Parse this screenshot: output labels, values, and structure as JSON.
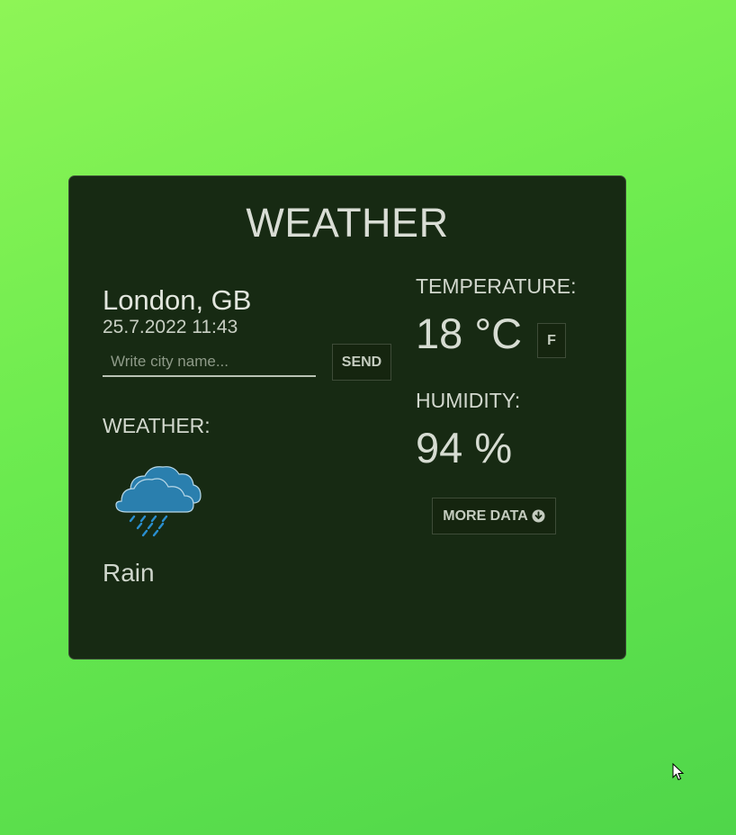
{
  "app": {
    "title": "WEATHER"
  },
  "location": {
    "city": "London, GB",
    "datetime": "25.7.2022 11:43"
  },
  "search": {
    "placeholder": "Write city name...",
    "value": "",
    "send_label": "SEND"
  },
  "weather": {
    "label": "WEATHER:",
    "icon": "rain-cloud-icon",
    "condition": "Rain"
  },
  "temperature": {
    "label": "TEMPERATURE:",
    "value": "18 °C",
    "unit_toggle_label": "F"
  },
  "humidity": {
    "label": "HUMIDITY:",
    "value": "94 %"
  },
  "more": {
    "label": "MORE DATA",
    "icon": "arrow-down-circle-icon"
  },
  "colors": {
    "background_start": "#8ef556",
    "background_end": "#4fd64a",
    "card": "#172a13",
    "cloud": "#2a7fae",
    "rain": "#2a8fd0"
  }
}
